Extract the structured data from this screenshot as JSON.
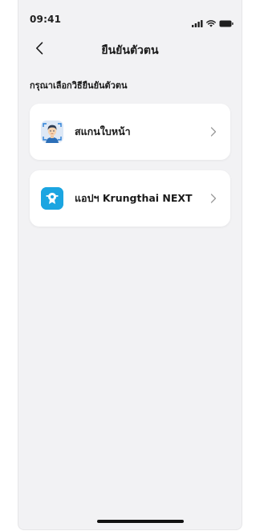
{
  "status_bar": {
    "time": "09:41",
    "icons": [
      "signal-icon",
      "wifi-icon",
      "battery-icon"
    ]
  },
  "nav": {
    "back_icon": "chevron-left-icon",
    "title": "ยืนยันตัวตน"
  },
  "section": {
    "label": "กรุณาเลือกวิธียืนยันตัวตน"
  },
  "options": [
    {
      "label": "สแกนใบหน้า",
      "icon": "face-scan-icon",
      "chevron": "chevron-right-icon"
    },
    {
      "label": "แอปฯ Krungthai NEXT",
      "icon": "krungthai-app-icon",
      "chevron": "chevron-right-icon"
    }
  ],
  "colors": {
    "background": "#f2f2f4",
    "card": "#ffffff",
    "accent_blue": "#1ba5e1",
    "text": "#1a1a1a",
    "chevron": "#9a9a9a"
  }
}
